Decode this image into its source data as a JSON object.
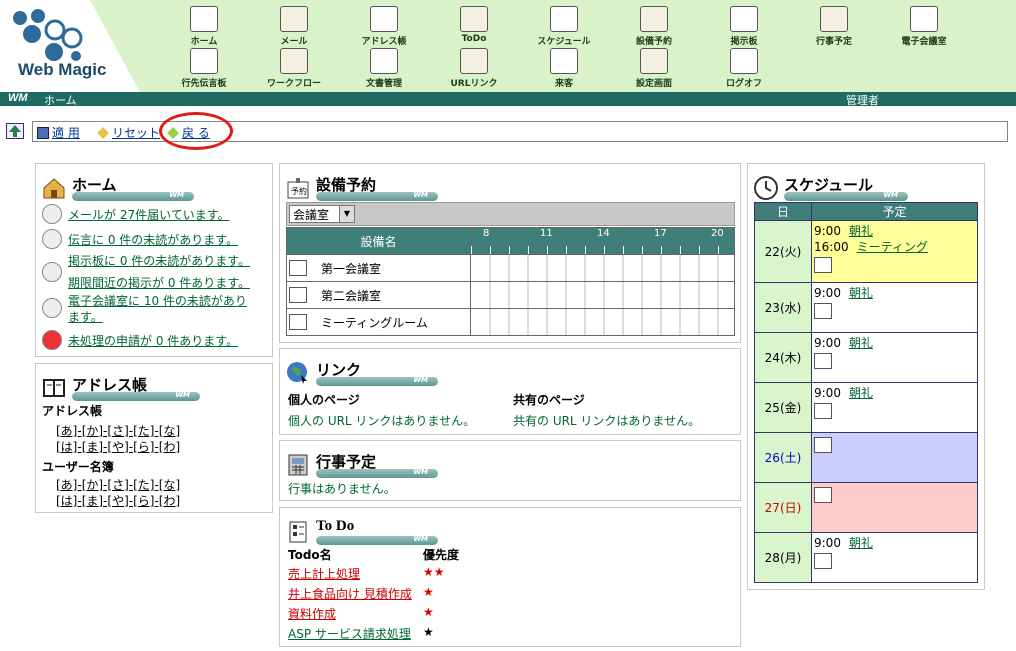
{
  "app": {
    "logo": "Web Magic",
    "page_title": "ホーム",
    "user": "管理者"
  },
  "nav": {
    "row1": [
      "ホーム",
      "メール",
      "アドレス帳",
      "ToDo",
      "スケジュール",
      "設備予約",
      "掲示板",
      "行事予定",
      "電子会議室"
    ],
    "row2": [
      "行先伝言板",
      "ワークフロー",
      "文書管理",
      "URLリンク",
      "来客",
      "設定画面",
      "ログオフ"
    ]
  },
  "toolbar": {
    "apply": "適 用",
    "reset": "リセット",
    "back": "戻 る"
  },
  "home": {
    "title": "ホーム",
    "items": [
      "メールが 27件届いています。",
      "伝言に 0 件の未読があります。",
      "掲示板に 0 件の未読があります。",
      "期限間近の掲示が 0 件あります。",
      "電子会議室に 10 件の未読があり",
      "ます。",
      "未処理の申請が 0 件あります。"
    ]
  },
  "address": {
    "title": "アドレス帳",
    "sec1": "アドレス帳",
    "sec2": "ユーザー名簿",
    "row_a": "[あ]-[か]-[さ]-[た]-[な]",
    "row_b": "[は]-[ま]-[や]-[ら]-[わ]"
  },
  "equip": {
    "title": "設備予約",
    "select": "会議室",
    "col": "設備名",
    "hours": [
      "8",
      "11",
      "14",
      "17",
      "20"
    ],
    "rows": [
      "第一会議室",
      "第二会議室",
      "ミーティングルーム"
    ]
  },
  "link": {
    "title": "リンク",
    "personal": "個人のページ",
    "shared": "共有のページ",
    "personal_msg": "個人の URL リンクはありません。",
    "shared_msg": "共有の URL リンクはありません。"
  },
  "event": {
    "title": "行事予定",
    "msg": "行事はありません。"
  },
  "todo": {
    "title": "To Do",
    "col_name": "Todo名",
    "col_pri": "優先度",
    "items": [
      {
        "name": "売上計上処理",
        "pri": "★★",
        "color": "#dd0000"
      },
      {
        "name": "井上食品向け 見積作成",
        "pri": "★",
        "color": "#dd0000"
      },
      {
        "name": "資料作成",
        "pri": "★",
        "color": "#dd0000"
      },
      {
        "name": "ASP サービス請求処理",
        "pri": "★",
        "color": "#000000"
      }
    ]
  },
  "schedule": {
    "title": "スケジュール",
    "col_day": "日",
    "col_plan": "予定",
    "days": [
      {
        "day": "22(火)",
        "bg": "#ffff99",
        "color": "#000000",
        "plans": [
          [
            "9:00",
            "朝礼"
          ],
          [
            "16:00",
            "ミーティング"
          ]
        ]
      },
      {
        "day": "23(水)",
        "bg": "#ffffff",
        "color": "#000000",
        "plans": [
          [
            "9:00",
            "朝礼"
          ]
        ]
      },
      {
        "day": "24(木)",
        "bg": "#ffffff",
        "color": "#000000",
        "plans": [
          [
            "9:00",
            "朝礼"
          ]
        ]
      },
      {
        "day": "25(金)",
        "bg": "#ffffff",
        "color": "#000000",
        "plans": [
          [
            "9:00",
            "朝礼"
          ]
        ]
      },
      {
        "day": "26(土)",
        "bg": "#ccccff",
        "color": "#0000cc",
        "plans": []
      },
      {
        "day": "27(日)",
        "bg": "#ffcccc",
        "color": "#cc0000",
        "plans": []
      },
      {
        "day": "28(月)",
        "bg": "#ffffff",
        "color": "#000000",
        "plans": [
          [
            "9:00",
            "朝礼"
          ]
        ]
      }
    ]
  }
}
